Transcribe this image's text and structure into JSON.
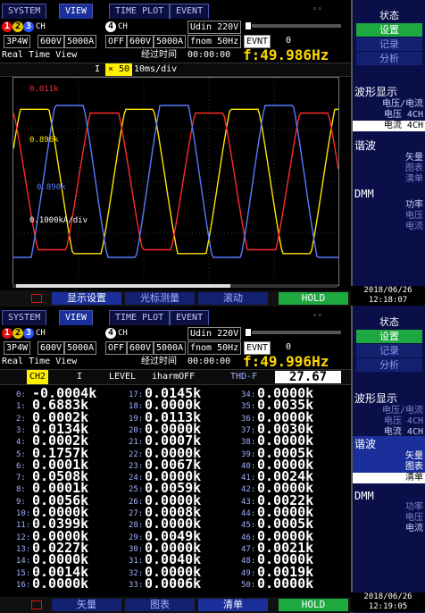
{
  "top": {
    "tabs": [
      "SYSTEM",
      "VIEW",
      "TIME PLOT",
      "EVENT"
    ],
    "active_tab": "VIEW",
    "wiring": "3P4W",
    "voltage_range": "600V",
    "current_range": "5000A",
    "ch4_mode": "OFF",
    "ch4_voltage": "600V",
    "ch4_current": "5000A",
    "udin": "Udin 220V",
    "fnom": "fnom 50Hz",
    "event_label": "EVNT",
    "event_count": "0",
    "ch_label": "CH",
    "realtime_label": "Real Time View",
    "elapsed_label": "经过时间",
    "elapsed_time": "00:00:00"
  },
  "panel1": {
    "frequency": "f:49.986Hz",
    "channel_sel": "I",
    "zoom": "× 50",
    "timebase": "10ms/div",
    "y_labels": [
      "0.011k",
      "0.896k",
      "0.890k",
      "0.1000kA/div"
    ],
    "waveform_colors": {
      "ch1": "#ff2a2a",
      "ch2": "#ffe500",
      "ch3": "#5a7bff",
      "ch4": "#ffffff"
    },
    "bottom_buttons": [
      "显示设置",
      "光标测量",
      "滚动",
      "HOLD"
    ],
    "side": {
      "status": "状态",
      "setup": "设置",
      "record": "记录",
      "analysis": "分析",
      "waveform_title": "波形显示",
      "wave_items": [
        "电压/电流",
        "电压 4CH",
        "电流 4CH"
      ],
      "harmonic_title": "谐波",
      "harm_items": [
        "矢量",
        "图表",
        "清单"
      ],
      "dmm_title": "DMM",
      "dmm_items": [
        "功率",
        "电压",
        "电流"
      ]
    },
    "date": "2018/06/26",
    "time": "12:18:07"
  },
  "panel2": {
    "frequency": "f:49.996Hz",
    "channel_sel": "CH2",
    "quantity": "I",
    "level": "LEVEL",
    "iharm": "iharmOFF",
    "thd_label": "THD-F",
    "thd_value": "27.67",
    "harmonics": [
      {
        "n": "0:",
        "v": "-0.0004k"
      },
      {
        "n": "1:",
        "v": "0.6883k"
      },
      {
        "n": "2:",
        "v": "0.0002k"
      },
      {
        "n": "3:",
        "v": "0.0134k"
      },
      {
        "n": "4:",
        "v": "0.0002k"
      },
      {
        "n": "5:",
        "v": "0.1757k"
      },
      {
        "n": "6:",
        "v": "0.0001k"
      },
      {
        "n": "7:",
        "v": "0.0508k"
      },
      {
        "n": "8:",
        "v": "0.0001k"
      },
      {
        "n": "9:",
        "v": "0.0056k"
      },
      {
        "n": "10:",
        "v": "0.0000k"
      },
      {
        "n": "11:",
        "v": "0.0399k"
      },
      {
        "n": "12:",
        "v": "0.0000k"
      },
      {
        "n": "13:",
        "v": "0.0227k"
      },
      {
        "n": "14:",
        "v": "0.0000k"
      },
      {
        "n": "15:",
        "v": "0.0014k"
      },
      {
        "n": "16:",
        "v": "0.0000k"
      },
      {
        "n": "17:",
        "v": "0.0145k"
      },
      {
        "n": "18:",
        "v": "0.0000k"
      },
      {
        "n": "19:",
        "v": "0.0113k"
      },
      {
        "n": "20:",
        "v": "0.0000k"
      },
      {
        "n": "21:",
        "v": "0.0007k"
      },
      {
        "n": "22:",
        "v": "0.0000k"
      },
      {
        "n": "23:",
        "v": "0.0067k"
      },
      {
        "n": "24:",
        "v": "0.0000k"
      },
      {
        "n": "25:",
        "v": "0.0059k"
      },
      {
        "n": "26:",
        "v": "0.0000k"
      },
      {
        "n": "27:",
        "v": "0.0008k"
      },
      {
        "n": "28:",
        "v": "0.0000k"
      },
      {
        "n": "29:",
        "v": "0.0049k"
      },
      {
        "n": "30:",
        "v": "0.0000k"
      },
      {
        "n": "31:",
        "v": "0.0040k"
      },
      {
        "n": "32:",
        "v": "0.0000k"
      },
      {
        "n": "33:",
        "v": "0.0006k"
      },
      {
        "n": "34:",
        "v": "0.0000k"
      },
      {
        "n": "35:",
        "v": "0.0035k"
      },
      {
        "n": "36:",
        "v": "0.0000k"
      },
      {
        "n": "37:",
        "v": "0.0030k"
      },
      {
        "n": "38:",
        "v": "0.0000k"
      },
      {
        "n": "39:",
        "v": "0.0005k"
      },
      {
        "n": "40:",
        "v": "0.0000k"
      },
      {
        "n": "41:",
        "v": "0.0024k"
      },
      {
        "n": "42:",
        "v": "0.0000k"
      },
      {
        "n": "43:",
        "v": "0.0022k"
      },
      {
        "n": "44:",
        "v": "0.0000k"
      },
      {
        "n": "45:",
        "v": "0.0005k"
      },
      {
        "n": "46:",
        "v": "0.0000k"
      },
      {
        "n": "47:",
        "v": "0.0021k"
      },
      {
        "n": "48:",
        "v": "0.0000k"
      },
      {
        "n": "49:",
        "v": "0.0019k"
      },
      {
        "n": "50:",
        "v": "0.0000k"
      }
    ],
    "bottom_buttons": [
      "矢量",
      "图表",
      "清单",
      "HOLD"
    ],
    "date": "2018/06/26",
    "time": "12:19:05"
  }
}
